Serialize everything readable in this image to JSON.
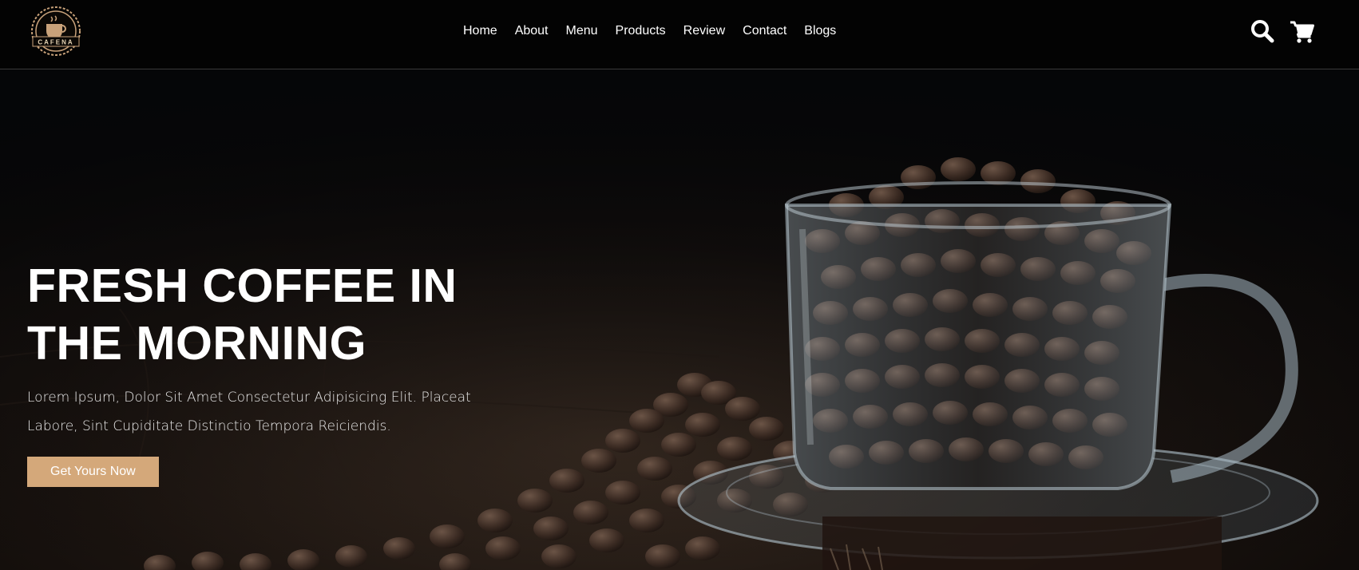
{
  "header": {
    "logo_text": "CAFENA",
    "nav": [
      "Home",
      "About",
      "Menu",
      "Products",
      "Review",
      "Contact",
      "Blogs"
    ],
    "icons": [
      "search-icon",
      "cart-icon"
    ]
  },
  "hero": {
    "title_line1": "FRESH COFFEE IN",
    "title_line2": "THE MORNING",
    "desc_line1": "Lorem Ipsum, Dolor Sit Amet Consectetur Adipisicing Elit. Placeat",
    "desc_line2": "Labore, Sint Cupiditate Distinctio Tempora Reiciendis.",
    "cta_label": "Get Yours Now"
  },
  "colors": {
    "accent": "#d4a87a",
    "background": "#030303",
    "text": "#ffffff"
  }
}
